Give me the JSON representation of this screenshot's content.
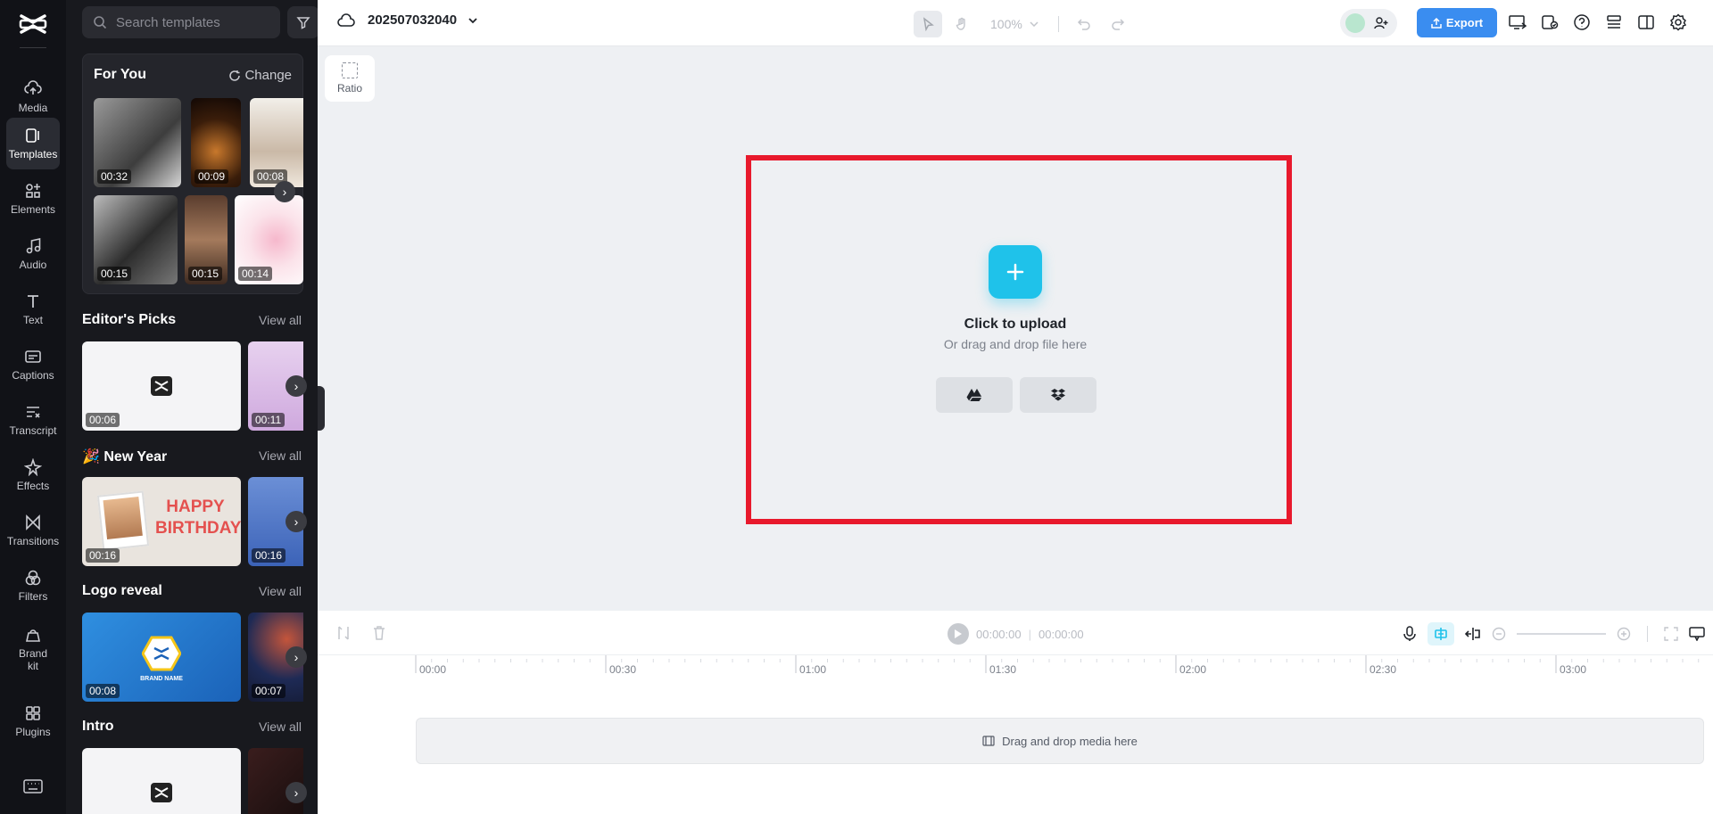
{
  "rail": {
    "items": [
      {
        "label": "Media"
      },
      {
        "label": "Templates"
      },
      {
        "label": "Elements"
      },
      {
        "label": "Audio"
      },
      {
        "label": "Text"
      },
      {
        "label": "Captions"
      },
      {
        "label": "Transcript"
      },
      {
        "label": "Effects"
      },
      {
        "label": "Transitions"
      },
      {
        "label": "Filters"
      },
      {
        "label": "Brand kit"
      },
      {
        "label": "Plugins"
      }
    ]
  },
  "panel": {
    "search_placeholder": "Search templates",
    "for_you": {
      "title": "For You",
      "change_label": "Change",
      "row1": [
        "00:32",
        "00:09",
        "00:08"
      ],
      "row2": [
        "00:15",
        "00:15",
        "00:14"
      ]
    },
    "sections": [
      {
        "title": "Editor's Picks",
        "view_all": "View all",
        "durations": [
          "00:06",
          "00:11"
        ]
      },
      {
        "title": "New Year",
        "view_all": "View all",
        "durations": [
          "00:16",
          "00:16"
        ],
        "thumb_text": "HAPPY BIRTHDAY"
      },
      {
        "title": "Logo reveal",
        "view_all": "View all",
        "durations": [
          "00:08",
          "00:07"
        ],
        "thumb_text": "BRAND NAME"
      },
      {
        "title": "Intro",
        "view_all": "View all"
      }
    ]
  },
  "topbar": {
    "project_name": "202507032040",
    "zoom": "100%",
    "export_label": "Export"
  },
  "canvas": {
    "ratio_label": "Ratio",
    "upload_title": "Click to upload",
    "upload_sub": "Or drag and drop file here"
  },
  "timeline": {
    "current_time": "00:00:00",
    "total_time": "00:00:00",
    "ticks": [
      "00:00",
      "00:30",
      "01:00",
      "01:30",
      "02:00",
      "02:30",
      "03:00"
    ],
    "track_hint": "Drag and drop media here"
  },
  "colors": {
    "accent": "#1fc2ea",
    "export": "#3a8df0",
    "highlight_frame": "#e8192c"
  }
}
